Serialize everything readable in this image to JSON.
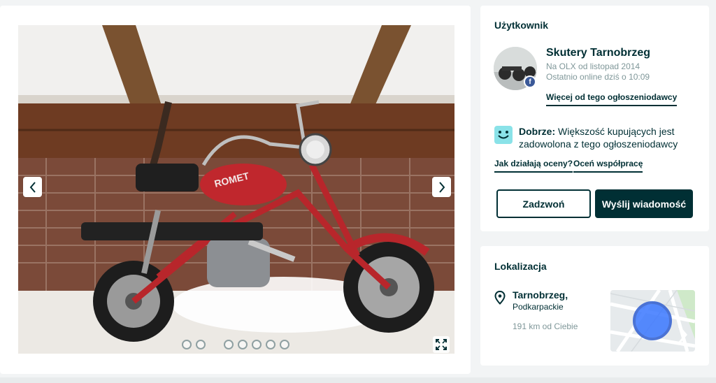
{
  "gallery": {
    "photo_alt": "ROMET",
    "prev_icon": "chevron-left-icon",
    "next_icon": "chevron-right-icon",
    "expand_icon": "expand-icon",
    "dot_count": 7
  },
  "user": {
    "section_title": "Użytkownik",
    "name": "Skutery Tarnobrzeg",
    "member_since": "Na OLX od listopad 2014",
    "last_online": "Ostatnio online dziś o 10:09",
    "more_link": "Więcej od tego ogłoszeniodawcy",
    "facebook_badge": "f",
    "rating_label": "Dobrze:",
    "rating_text": " Większość kupujących jest zadowolona z tego ogłoszeniodawcy",
    "how_ratings_link": "Jak działają oceny?",
    "rate_link": "Oceń współpracę",
    "call_button": "Zadzwoń",
    "message_button": "Wyślij wiadomość"
  },
  "location": {
    "section_title": "Lokalizacja",
    "city": "Tarnobrzeg,",
    "region": "Podkarpackie",
    "distance": "191 km od Ciebie"
  },
  "colors": {
    "brand": "#002f34",
    "smiley": "#8ae2e8",
    "map_marker": "#3a77ff"
  }
}
